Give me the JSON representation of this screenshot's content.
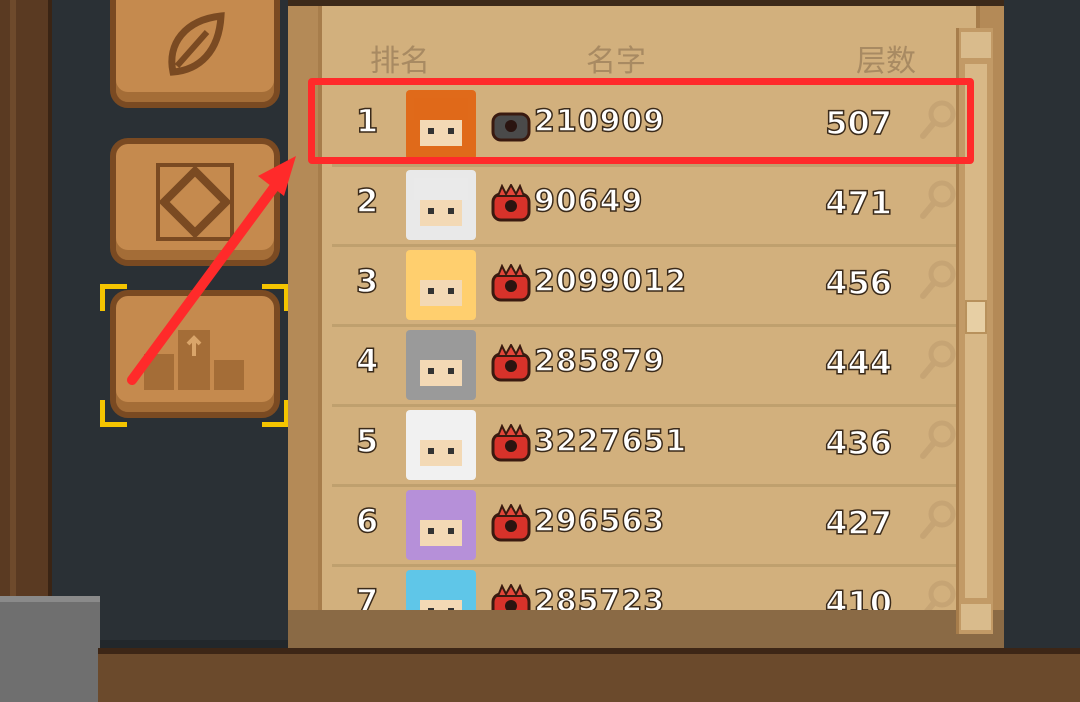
{
  "header": {
    "rank_label": "排名",
    "name_label": "名字",
    "floor_label": "层数"
  },
  "rows": [
    {
      "rank": "1",
      "name": "210909",
      "score": "507",
      "badge": "gray",
      "avatar_color": "#e06a1a"
    },
    {
      "rank": "2",
      "name": "90649",
      "score": "471",
      "badge": "red",
      "avatar_color": "#e9e9e9"
    },
    {
      "rank": "3",
      "name": "2099012",
      "score": "456",
      "badge": "red",
      "avatar_color": "#ffcf6e"
    },
    {
      "rank": "4",
      "name": "285879",
      "score": "444",
      "badge": "red",
      "avatar_color": "#9a9a9a"
    },
    {
      "rank": "5",
      "name": "3227651",
      "score": "436",
      "badge": "red",
      "avatar_color": "#f1f1f1"
    },
    {
      "rank": "6",
      "name": "296563",
      "score": "427",
      "badge": "red",
      "avatar_color": "#b690d9"
    },
    {
      "rank": "7",
      "name": "285723",
      "score": "410",
      "badge": "red",
      "avatar_color": "#5fc6e8"
    }
  ],
  "colors": {
    "highlight": "#ff2a2a",
    "badge_red": "#d8322a",
    "badge_gray": "#4a4a4a",
    "selected_corner": "#f5c400"
  },
  "icons": [
    "leaf-icon",
    "diamond-icon",
    "rank-bars-icon",
    "magnifier-icon"
  ]
}
